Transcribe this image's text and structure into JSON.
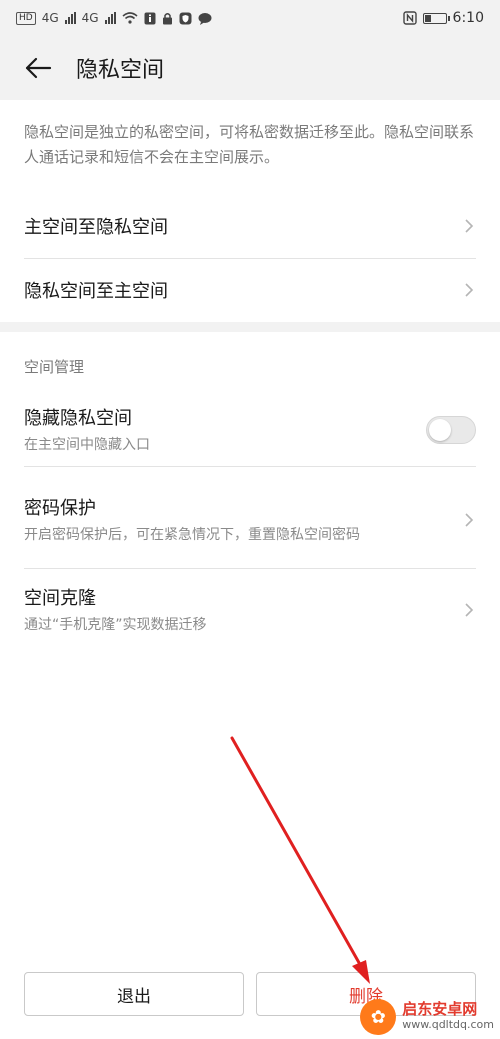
{
  "status_bar": {
    "network_hd": "HD",
    "network_4g_1": "4G",
    "network_4g_2": "4G",
    "time": "6:10"
  },
  "app_bar": {
    "title": "隐私空间"
  },
  "description": "隐私空间是独立的私密空间，可将私密数据迁移至此。隐私空间联系人通话记录和短信不会在主空间展示。",
  "migration_rows": [
    {
      "label": "主空间至隐私空间"
    },
    {
      "label": "隐私空间至主空间"
    }
  ],
  "section": {
    "header": "空间管理"
  },
  "hide_space": {
    "label": "隐藏隐私空间",
    "subtitle": "在主空间中隐藏入口",
    "toggle_on": false
  },
  "password_protection": {
    "label": "密码保护",
    "subtitle": "开启密码保护后，可在紧急情况下，重置隐私空间密码"
  },
  "space_clone": {
    "label": "空间克隆",
    "subtitle": "通过“手机克隆”实现数据迁移"
  },
  "buttons": {
    "exit": "退出",
    "delete": "删除"
  },
  "colors": {
    "accent_red": "#e23b2e",
    "annotation_arrow": "#e02020"
  },
  "watermark": {
    "title": "启东安卓网",
    "url": "www.qdltdq.com"
  }
}
